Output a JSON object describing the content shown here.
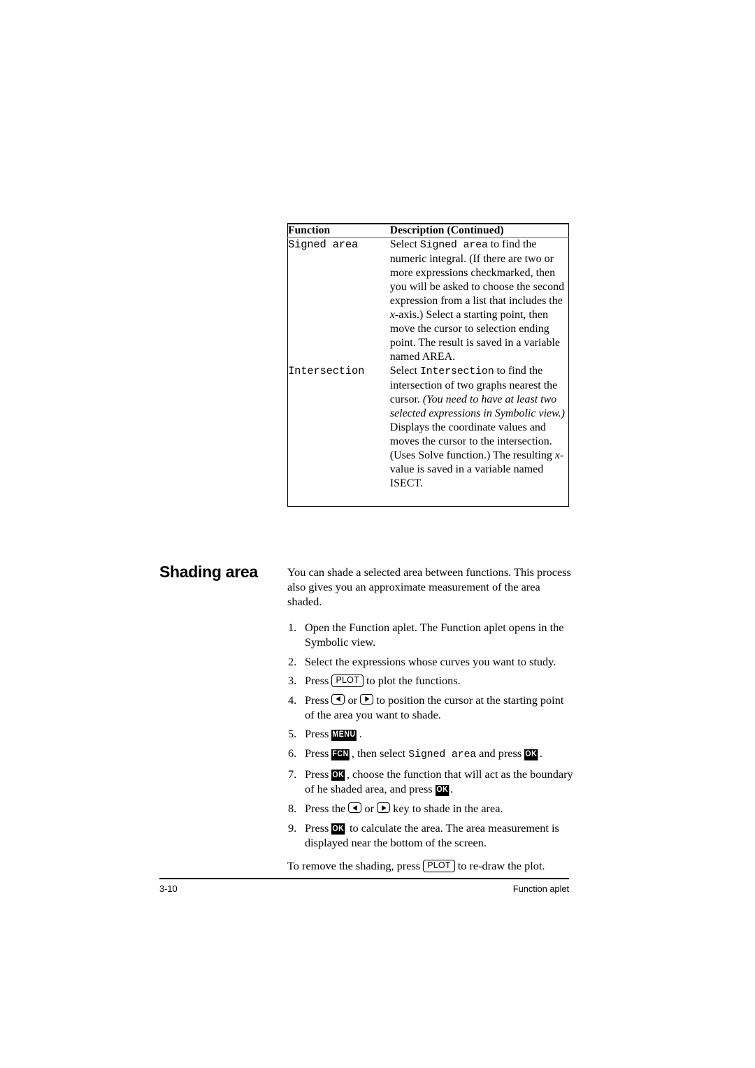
{
  "table": {
    "headers": {
      "function": "Function",
      "description": "Description  (Continued)"
    },
    "rows": [
      {
        "function": "Signed area",
        "description_parts": {
          "p1": "Select ",
          "mono1": "Signed area",
          "p2": " to find the numeric integral. (If there are two or more expressions checkmarked, then you will be asked to choose the second expression from a list that includes the ",
          "var1": "x",
          "p3": "-axis.) Select a starting point, then move the cursor to selection ending point. The result is saved in a variable named AREA."
        }
      },
      {
        "function": "Intersection",
        "description_parts": {
          "p1": "Select ",
          "mono1": "Intersection",
          "p2": " to find the intersection of two graphs nearest the cursor. ",
          "ital1": "(You need to have at least two selected expressions in Symbolic view.)",
          "p3": " Displays the coordinate values and moves the cursor to the intersection. (Uses Solve function.) The resulting ",
          "var1": "x",
          "p4": "-value is saved in a variable named ISECT."
        }
      }
    ]
  },
  "section": {
    "heading": "Shading area",
    "intro": "You can shade a selected area between functions. This process also gives you an approximate measurement of the area shaded."
  },
  "steps": [
    {
      "num": "1.",
      "text": "Open the Function aplet. The Function aplet opens in the Symbolic view."
    },
    {
      "num": "2.",
      "text": "Select the expressions whose curves you want to study."
    },
    {
      "num": "3.",
      "pre": "Press ",
      "key": "PLOT",
      "post": " to plot the functions."
    },
    {
      "num": "4.",
      "pre": "Press ",
      "mid": " or ",
      "post": " to position the cursor at the starting point of the area you want to shade."
    },
    {
      "num": "5.",
      "pre": "Press ",
      "softkey": "MENU",
      "post": "."
    },
    {
      "num": "6.",
      "pre": "Press ",
      "softkey": "FCN",
      "mid": ", then select ",
      "mono": "Signed area",
      "mid2": " and press ",
      "softkey2": "OK",
      "post": "."
    },
    {
      "num": "7.",
      "pre": "Press ",
      "softkey": "OK",
      "mid": ", choose the function that will act as the boundary of he shaded area, and press ",
      "softkey2": "OK",
      "post": "."
    },
    {
      "num": "8.",
      "pre": "Press the ",
      "mid": " or ",
      "post": " key to shade in the area."
    },
    {
      "num": "9.",
      "pre": "Press ",
      "softkey": "OK",
      "post": " to calculate the area. The area measurement is displayed near the bottom of the screen."
    }
  ],
  "closing": {
    "pre": "To remove the shading, press ",
    "key": "PLOT",
    "post": " to re-draw the plot."
  },
  "footer": {
    "page_number": "3-10",
    "chapter": "Function aplet"
  }
}
